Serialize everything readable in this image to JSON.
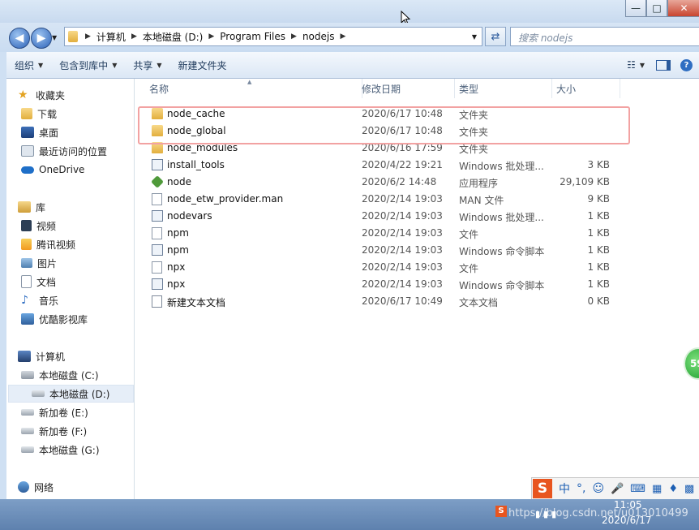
{
  "window": {
    "minimize_glyph": "—",
    "maximize_glyph": "□",
    "close_glyph": "✕"
  },
  "address": {
    "crumbs": [
      "计算机",
      "本地磁盘 (D:)",
      "Program Files",
      "nodejs"
    ],
    "search_placeholder": "搜索 nodejs"
  },
  "toolbar": {
    "organize": "组织",
    "include_in_library": "包含到库中",
    "share": "共享",
    "new_folder": "新建文件夹"
  },
  "nav": {
    "favorites": "收藏夹",
    "downloads": "下载",
    "desktop": "桌面",
    "recent": "最近访问的位置",
    "onedrive": "OneDrive",
    "libraries": "库",
    "videos": "视频",
    "tencent_video": "腾讯视频",
    "pictures": "图片",
    "documents": "文档",
    "music": "音乐",
    "youku": "优酷影视库",
    "computer": "计算机",
    "drive_c": "本地磁盘 (C:)",
    "drive_d": "本地磁盘 (D:)",
    "drive_e": "新加卷 (E:)",
    "drive_f": "新加卷 (F:)",
    "drive_g": "本地磁盘 (G:)",
    "network": "网络"
  },
  "columns": {
    "name": "名称",
    "date": "修改日期",
    "type": "类型",
    "size": "大小"
  },
  "files": [
    {
      "name": "node_cache",
      "date": "2020/6/17 10:48",
      "type": "文件夹",
      "size": "",
      "icon": "folder-icon"
    },
    {
      "name": "node_global",
      "date": "2020/6/17 10:48",
      "type": "文件夹",
      "size": "",
      "icon": "folder-icon"
    },
    {
      "name": "node_modules",
      "date": "2020/6/16 17:59",
      "type": "文件夹",
      "size": "",
      "icon": "folder-icon"
    },
    {
      "name": "install_tools",
      "date": "2020/4/22 19:21",
      "type": "Windows 批处理...",
      "size": "3 KB",
      "icon": "batch-file-icon"
    },
    {
      "name": "node",
      "date": "2020/6/2 14:48",
      "type": "应用程序",
      "size": "29,109 KB",
      "icon": "node-app-icon"
    },
    {
      "name": "node_etw_provider.man",
      "date": "2020/2/14 19:03",
      "type": "MAN 文件",
      "size": "9 KB",
      "icon": "file-icon"
    },
    {
      "name": "nodevars",
      "date": "2020/2/14 19:03",
      "type": "Windows 批处理...",
      "size": "1 KB",
      "icon": "batch-file-icon"
    },
    {
      "name": "npm",
      "date": "2020/2/14 19:03",
      "type": "文件",
      "size": "1 KB",
      "icon": "file-icon"
    },
    {
      "name": "npm",
      "date": "2020/2/14 19:03",
      "type": "Windows 命令脚本",
      "size": "1 KB",
      "icon": "batch-file-icon"
    },
    {
      "name": "npx",
      "date": "2020/2/14 19:03",
      "type": "文件",
      "size": "1 KB",
      "icon": "file-icon"
    },
    {
      "name": "npx",
      "date": "2020/2/14 19:03",
      "type": "Windows 命令脚本",
      "size": "1 KB",
      "icon": "batch-file-icon"
    },
    {
      "name": "新建文本文档",
      "date": "2020/6/17 10:49",
      "type": "文本文档",
      "size": "0 KB",
      "icon": "text-file-icon"
    }
  ],
  "ime": {
    "logo": "S",
    "lang": "中",
    "punct": "°,"
  },
  "badge_value": "59",
  "taskbar": {
    "clock_time": "11:05",
    "clock_date": "2020/6/17",
    "watermark": "https://blog.csdn.net/u013010499"
  },
  "colors": {
    "highlight_border": "#f2a2a2",
    "accent": "#1e395b"
  }
}
